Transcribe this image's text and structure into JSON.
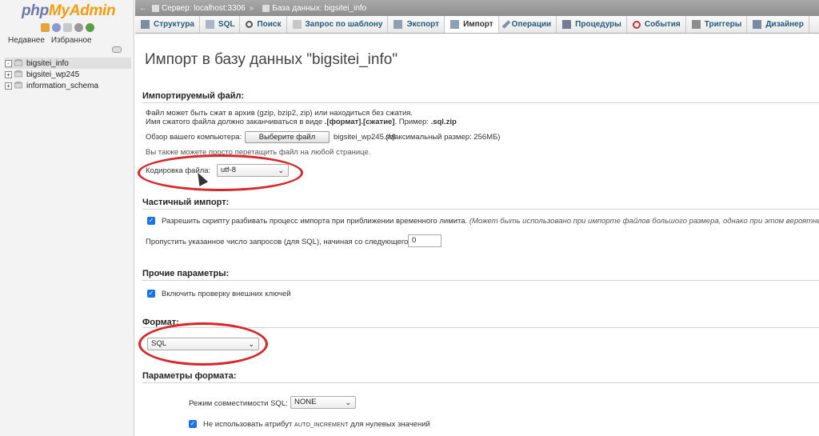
{
  "nav": {
    "logo_part1": "php",
    "logo_part2": "MyAdmin",
    "icons": [
      "home-icon",
      "info-icon",
      "docs-icon",
      "settings-icon",
      "reload-icon"
    ],
    "tab_recent": "Недавнее",
    "tab_favorites": "Избранное",
    "databases": [
      {
        "name": "bigsitei_info",
        "selected": true,
        "expander": "-"
      },
      {
        "name": "bigsitei_wp245",
        "selected": false,
        "expander": "+"
      },
      {
        "name": "information_schema",
        "selected": false,
        "expander": "+"
      }
    ]
  },
  "breadcrumb": {
    "server": "Сервер: localhost:3306",
    "separator": "»",
    "database": "База данных: bigsitei_info"
  },
  "tabs": [
    {
      "label": "Структура",
      "icon": "structure-icon",
      "active": false
    },
    {
      "label": "SQL",
      "icon": "sql-icon",
      "active": false
    },
    {
      "label": "Поиск",
      "icon": "search-icon",
      "active": false
    },
    {
      "label": "Запрос по шаблону",
      "icon": "query-icon",
      "active": false
    },
    {
      "label": "Экспорт",
      "icon": "export-icon",
      "active": false
    },
    {
      "label": "Импорт",
      "icon": "import-icon",
      "active": true
    },
    {
      "label": "Операции",
      "icon": "wrench-icon",
      "active": false
    },
    {
      "label": "Процедуры",
      "icon": "routines-icon",
      "active": false
    },
    {
      "label": "События",
      "icon": "clock-icon",
      "active": false
    },
    {
      "label": "Триггеры",
      "icon": "triggers-icon",
      "active": false
    },
    {
      "label": "Дизайнер",
      "icon": "designer-icon",
      "active": false
    }
  ],
  "main": {
    "title": "Импорт в базу данных \"bigsitei_info\"",
    "file_section": {
      "heading": "Импортируемый файл:",
      "line1": "Файл может быть сжат в архив (gzip, bzip2, zip) или находиться без сжатия.",
      "line2_prefix": "Имя сжатого файла должно заканчиваться в виде ",
      "line2_bold": ".[формат].[сжатие]",
      "line2_mid": ". Пример: ",
      "line2_example": ".sql.zip",
      "browse_label": "Обзор вашего компьютера:",
      "choose_button": "Выберите файл",
      "file_name": "bigsitei_wp245.sql",
      "max_size": "(Максимальный размер: 256МБ)",
      "drag_note": "Вы также можете просто перетащить файл на любой странице.",
      "encoding_label": "Кодировка файла:",
      "encoding_value": "utf-8"
    },
    "partial_section": {
      "heading": "Частичный импорт:",
      "allow_interrupt_checked": true,
      "allow_interrupt_label": "Разрешить скрипту разбивать процесс импорта при приближении временного лимита.",
      "allow_interrupt_note": "(Может быть использовано при импорте файлов большого размера, однако при этом вероятны пробл",
      "skip_label": "Пропустить указанное число запросов (для SQL), начиная со следующего:",
      "skip_value": "0"
    },
    "other_section": {
      "heading": "Прочие параметры:",
      "fk_checked": true,
      "fk_label": "Включить проверку внешних ключей"
    },
    "format_section": {
      "heading": "Формат:",
      "format_value": "SQL"
    },
    "format_options_section": {
      "heading": "Параметры формата:",
      "compat_label": "Режим совместимости SQL:",
      "compat_value": "NONE",
      "no_auto_checked": true,
      "no_auto_prefix": "Не использовать атрибут ",
      "no_auto_code": "AUTO_INCREMENT",
      "no_auto_suffix": " для нулевых значений"
    }
  },
  "colors": {
    "accent_red": "#d8262b",
    "link_blue": "#235a81",
    "checkbox_blue": "#1a73e8",
    "logo_blue": "#6c78af",
    "logo_orange": "#f89c0e"
  }
}
